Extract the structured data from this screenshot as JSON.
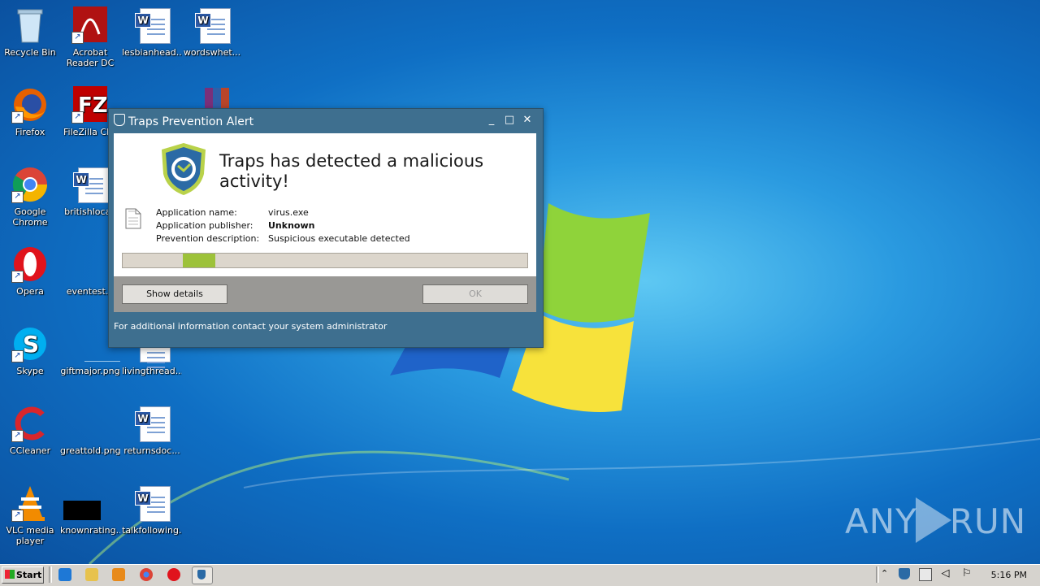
{
  "desktop": {
    "icons": [
      {
        "label": "Recycle Bin"
      },
      {
        "label": "Acrobat Reader DC"
      },
      {
        "label": "lesbianhead..."
      },
      {
        "label": "wordswhet..."
      },
      {
        "label": "Firefox"
      },
      {
        "label": "FileZilla Clie"
      },
      {
        "label": "Google Chrome"
      },
      {
        "label": "britishlocal."
      },
      {
        "label": "Opera"
      },
      {
        "label": "eventest.p"
      },
      {
        "label": "Skype"
      },
      {
        "label": "giftmajor.png"
      },
      {
        "label": "livingthread..."
      },
      {
        "label": "CCleaner"
      },
      {
        "label": "greattold.png"
      },
      {
        "label": "returnsdoc..."
      },
      {
        "label": "VLC media player"
      },
      {
        "label": "knownrating..."
      },
      {
        "label": "talkfollowing..."
      }
    ],
    "watermark": "ANY RUN"
  },
  "dialog": {
    "title": "Traps Prevention Alert",
    "headline": "Traps has detected a malicious activity!",
    "fields": [
      {
        "label": "Application name:",
        "value": "virus.exe"
      },
      {
        "label": "Application publisher:",
        "value": "Unknown"
      },
      {
        "label": "Prevention description:",
        "value": "Suspicious executable detected"
      }
    ],
    "progress": 0.15,
    "show_details_label": "Show details",
    "ok_label": "OK",
    "footer": "For additional information contact your system administrator",
    "colors": {
      "frame": "#3e6f8f",
      "progress_fill": "#9dc23a"
    }
  },
  "taskbar": {
    "start_label": "Start",
    "quicklaunch": [
      "ie-icon",
      "explorer-icon",
      "media-player-icon",
      "chrome-icon",
      "opera-icon",
      "traps-icon"
    ],
    "clock": "5:16 PM"
  }
}
